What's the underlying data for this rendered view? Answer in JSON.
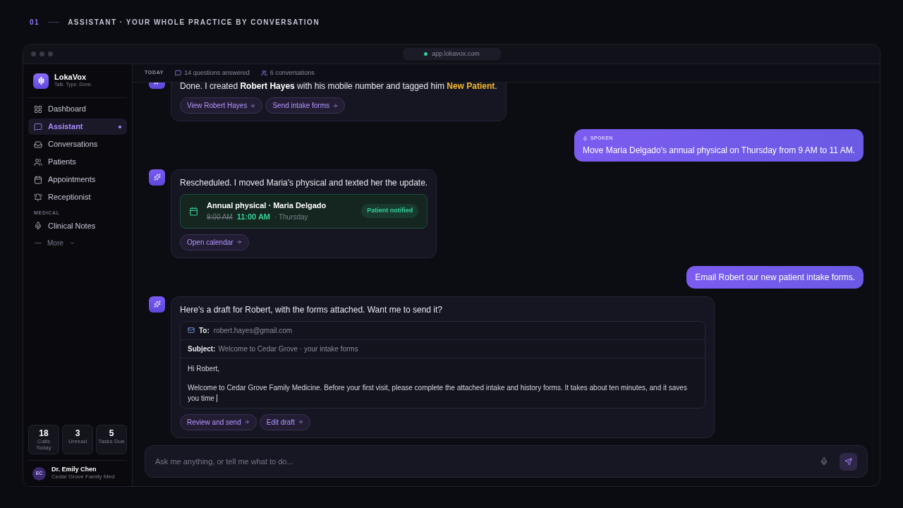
{
  "header": {
    "number": "01",
    "title": "ASSISTANT · YOUR WHOLE PRACTICE BY CONVERSATION"
  },
  "browser": {
    "url": "app.lokavox.com",
    "secure": true
  },
  "brand": {
    "name": "LokaVox",
    "tagline": "Talk. Type. Done."
  },
  "nav": [
    {
      "label": "Dashboard",
      "selected": false,
      "dot": false
    },
    {
      "label": "Assistant",
      "selected": true,
      "dot": true
    },
    {
      "label": "Conversations",
      "selected": false,
      "dot": false
    },
    {
      "label": "Patients",
      "selected": false,
      "dot": false
    },
    {
      "label": "Appointments",
      "selected": false,
      "dot": false
    },
    {
      "label": "Receptionist",
      "selected": false,
      "dot": false
    }
  ],
  "nav_section": "MEDICAL",
  "nav_medical": [
    {
      "label": "Clinical Notes",
      "selected": false,
      "dot": false
    }
  ],
  "more": "More",
  "stats": [
    {
      "value": "18",
      "label": "Calls Today"
    },
    {
      "value": "3",
      "label": "Unread"
    },
    {
      "value": "5",
      "label": "Tasks Due"
    }
  ],
  "user": {
    "initials": "EC",
    "name": "Dr. Emily Chen",
    "org": "Cedar Grove Family Med"
  },
  "topbar": {
    "day": "TODAY",
    "questions": "14 questions answered",
    "conversations": "6 conversations"
  },
  "messages": [
    {
      "kind": "assistant",
      "segments": [
        {
          "kind": "plain",
          "text": "Done. I created "
        },
        {
          "kind": "bold",
          "text": "Robert Hayes"
        },
        {
          "kind": "plain",
          "text": " with his mobile number and tagged him "
        },
        {
          "kind": "tag",
          "text": "New Patient"
        },
        {
          "kind": "plain",
          "text": "."
        }
      ],
      "actions": [
        "View Robert Hayes",
        "Send intake forms"
      ]
    },
    {
      "kind": "user",
      "spoken": "SPOKEN",
      "text": "Move Maria Delgado's annual physical on Thursday from 9 AM to 11 AM."
    },
    {
      "kind": "assistant",
      "segments": [
        {
          "kind": "plain",
          "text": "Rescheduled. I moved Maria's physical and texted her the update."
        }
      ],
      "appointment": {
        "title": "Annual physical · Maria Delgado",
        "old_time": "9:00 AM",
        "new_time": "11:00 AM",
        "day": "· Thursday",
        "badge": "Patient notified"
      },
      "actions": [
        "Open calendar"
      ]
    },
    {
      "kind": "user",
      "text": "Email Robert our new patient intake forms."
    },
    {
      "kind": "assistant",
      "segments": [
        {
          "kind": "plain",
          "text": "Here's a draft for Robert, with the forms attached. Want me to send it?"
        }
      ],
      "email": {
        "to_label": "To:",
        "to": "robert.hayes@gmail.com",
        "subject_label": "Subject:",
        "subject": "Welcome to Cedar Grove · your intake forms",
        "body": [
          "Hi Robert,",
          "Welcome to Cedar Grove Family Medicine. Before your first visit, please complete the attached intake and history forms. It takes about ten minutes, and it saves you time"
        ],
        "editing": true
      },
      "actions": [
        "Review and send",
        "Edit draft"
      ]
    }
  ],
  "composer": {
    "placeholder": "Ask me anything, or tell me what to do..."
  }
}
